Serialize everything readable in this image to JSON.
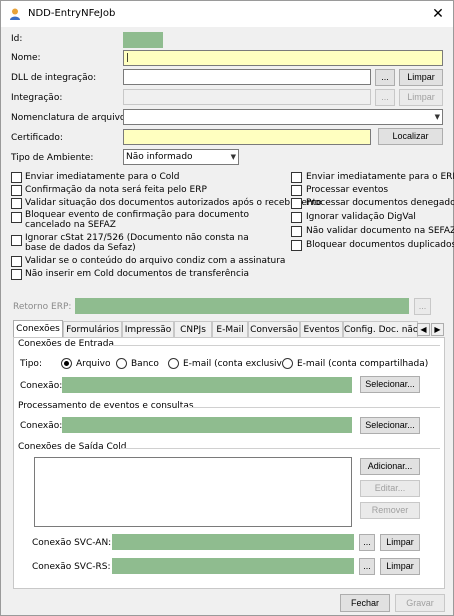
{
  "window": {
    "title": "NDD-EntryNFeJob",
    "close_glyph": "✕"
  },
  "form": {
    "id_label": "Id:",
    "nome_label": "Nome:",
    "nome_value": "|",
    "dll_label": "DLL de integração:",
    "integracao_label": "Integração:",
    "nomenclatura_label": "Nomenclatura de arquivo:",
    "certificado_label": "Certificado:",
    "tipo_ambiente_label": "Tipo de Ambiente:",
    "tipo_ambiente_value": "Não informado",
    "browse_label": "...",
    "limpar_label": "Limpar",
    "localizar_label": "Localizar"
  },
  "checks_left": [
    "Enviar imediatamente para o Cold",
    "Confirmação da nota será feita pelo ERP",
    "Validar situação dos documentos autorizados após o recebimento",
    "Bloquear evento de confirmação para documento cancelado na SEFAZ",
    "Ignorar cStat 217/526 (Documento não consta na base de dados da Sefaz)",
    "Validar se o conteúdo do arquivo condiz com a assinatura",
    "Não inserir em Cold documentos de transferência"
  ],
  "checks_left_lines": [
    [
      "Enviar imediatamente para o Cold"
    ],
    [
      "Confirmação da nota será feita pelo ERP"
    ],
    [
      "Validar situação dos documentos autorizados após o recebimento"
    ],
    [
      "Bloquear evento de confirmação para documento",
      "cancelado na SEFAZ"
    ],
    [
      "Ignorar cStat 217/526 (Documento não consta na",
      "base de dados da Sefaz)"
    ],
    [
      "Validar se o conteúdo do arquivo condiz com a assinatura"
    ],
    [
      "Não inserir em Cold documentos de transferência"
    ]
  ],
  "checks_right": [
    "Enviar imediatamente para o ERP",
    "Processar eventos",
    "Processar documentos denegados",
    "Ignorar validação DigVal",
    "Não validar documento na SEFAZ",
    "Bloquear documentos duplicados"
  ],
  "retorno_erp_label": "Retorno ERP:",
  "tabs": [
    "Conexões",
    "Formulários",
    "Impressão",
    "CNPJs",
    "E-Mail",
    "Conversão",
    "Eventos",
    "Config. Doc. não"
  ],
  "tab_scroll": {
    "left": "◀",
    "right": "▶"
  },
  "conexoes": {
    "entrada_header": "Conexões de Entrada",
    "tipo_label": "Tipo:",
    "tipo_options": [
      "Arquivo",
      "Banco",
      "E-mail (conta exclusiva)",
      "E-mail (conta compartilhada)"
    ],
    "tipo_selected": "Arquivo",
    "conexao_label": "Conexão:",
    "selecionar_label": "Selecionar...",
    "eventos_header": "Processamento de eventos e consultas",
    "saida_header": "Conexões de Saída Cold",
    "adicionar_label": "Adicionar...",
    "editar_label": "Editar...",
    "remover_label": "Remover",
    "svc_an_label": "Conexão SVC-AN:",
    "svc_rs_label": "Conexão SVC-RS:"
  },
  "footer": {
    "fechar_label": "Fechar",
    "gravar_label": "Gravar"
  },
  "colors": {
    "accent_field": "#8fbc8f",
    "required_field": "#ffffc0"
  }
}
